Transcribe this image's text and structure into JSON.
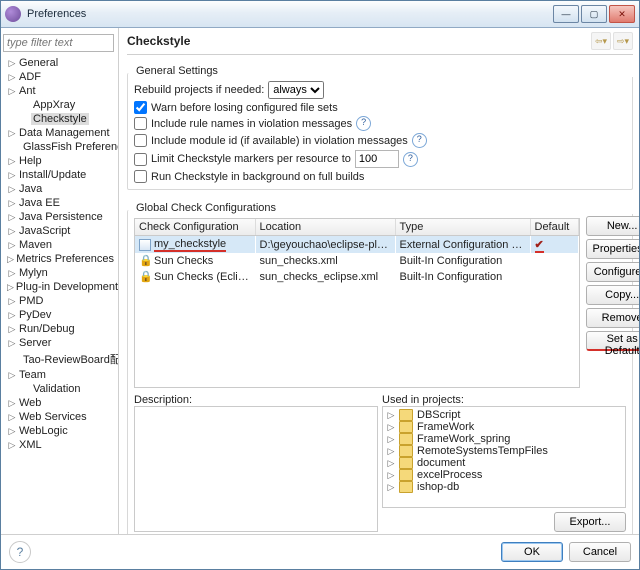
{
  "window": {
    "title": "Preferences"
  },
  "filter": {
    "placeholder": "type filter text"
  },
  "sidebar": {
    "items": [
      {
        "label": "General",
        "exp": true
      },
      {
        "label": "ADF",
        "exp": true
      },
      {
        "label": "Ant",
        "exp": true
      },
      {
        "label": "AppXray",
        "exp": false,
        "child": true
      },
      {
        "label": "Checkstyle",
        "exp": false,
        "child": true,
        "selected": true
      },
      {
        "label": "Data Management",
        "exp": true
      },
      {
        "label": "GlassFish Preferences",
        "exp": false,
        "child": true
      },
      {
        "label": "Help",
        "exp": true
      },
      {
        "label": "Install/Update",
        "exp": true
      },
      {
        "label": "Java",
        "exp": true
      },
      {
        "label": "Java EE",
        "exp": true
      },
      {
        "label": "Java Persistence",
        "exp": true
      },
      {
        "label": "JavaScript",
        "exp": true
      },
      {
        "label": "Maven",
        "exp": true
      },
      {
        "label": "Metrics Preferences",
        "exp": true
      },
      {
        "label": "Mylyn",
        "exp": true
      },
      {
        "label": "Plug-in Development",
        "exp": true
      },
      {
        "label": "PMD",
        "exp": true
      },
      {
        "label": "PyDev",
        "exp": true
      },
      {
        "label": "Run/Debug",
        "exp": true
      },
      {
        "label": "Server",
        "exp": true
      },
      {
        "label": "Tao-ReviewBoard配置",
        "exp": false,
        "child": true
      },
      {
        "label": "Team",
        "exp": true
      },
      {
        "label": "Validation",
        "exp": false,
        "child": true
      },
      {
        "label": "Web",
        "exp": true
      },
      {
        "label": "Web Services",
        "exp": true
      },
      {
        "label": "WebLogic",
        "exp": true
      },
      {
        "label": "XML",
        "exp": true
      }
    ]
  },
  "page": {
    "title": "Checkstyle"
  },
  "general": {
    "group_title": "General Settings",
    "rebuild_label": "Rebuild projects if needed:",
    "rebuild_value": "always",
    "warn_label": "Warn before losing configured file sets",
    "warn_checked": true,
    "include_rule_label": "Include rule names in violation messages",
    "include_rule_checked": false,
    "include_module_label": "Include module id (if available) in violation messages",
    "include_module_checked": false,
    "limit_label": "Limit Checkstyle markers per resource to",
    "limit_checked": false,
    "limit_value": "100",
    "bg_label": "Run Checkstyle in background on full builds",
    "bg_checked": false
  },
  "global": {
    "group_title": "Global Check Configurations",
    "headers": {
      "name": "Check Configuration",
      "location": "Location",
      "type": "Type",
      "default": "Default"
    },
    "rows": [
      {
        "icon": "doc",
        "name": "my_checkstyle",
        "location": "D:\\geyouchao\\eclipse-plugin...",
        "type": "External Configuration File",
        "default": "✔",
        "selected": true,
        "nameRed": true
      },
      {
        "icon": "lock",
        "name": "Sun Checks",
        "location": "sun_checks.xml",
        "type": "Built-In Configuration",
        "default": ""
      },
      {
        "icon": "lock",
        "name": "Sun Checks (Eclipse)",
        "location": "sun_checks_eclipse.xml",
        "type": "Built-In Configuration",
        "default": ""
      }
    ],
    "buttons": {
      "new": "New...",
      "properties": "Properties...",
      "configure": "Configure...",
      "copy": "Copy...",
      "remove": "Remove",
      "set_default": "Set as Default"
    }
  },
  "desc": {
    "label": "Description:",
    "projects_label": "Used in projects:"
  },
  "projects": {
    "items": [
      {
        "label": "DBScript"
      },
      {
        "label": "FrameWork"
      },
      {
        "label": "FrameWork_spring"
      },
      {
        "label": "RemoteSystemsTempFiles"
      },
      {
        "label": "document"
      },
      {
        "label": "excelProcess"
      },
      {
        "label": "ishop-db"
      }
    ]
  },
  "export_label": "Export...",
  "footer": {
    "ok": "OK",
    "cancel": "Cancel"
  }
}
